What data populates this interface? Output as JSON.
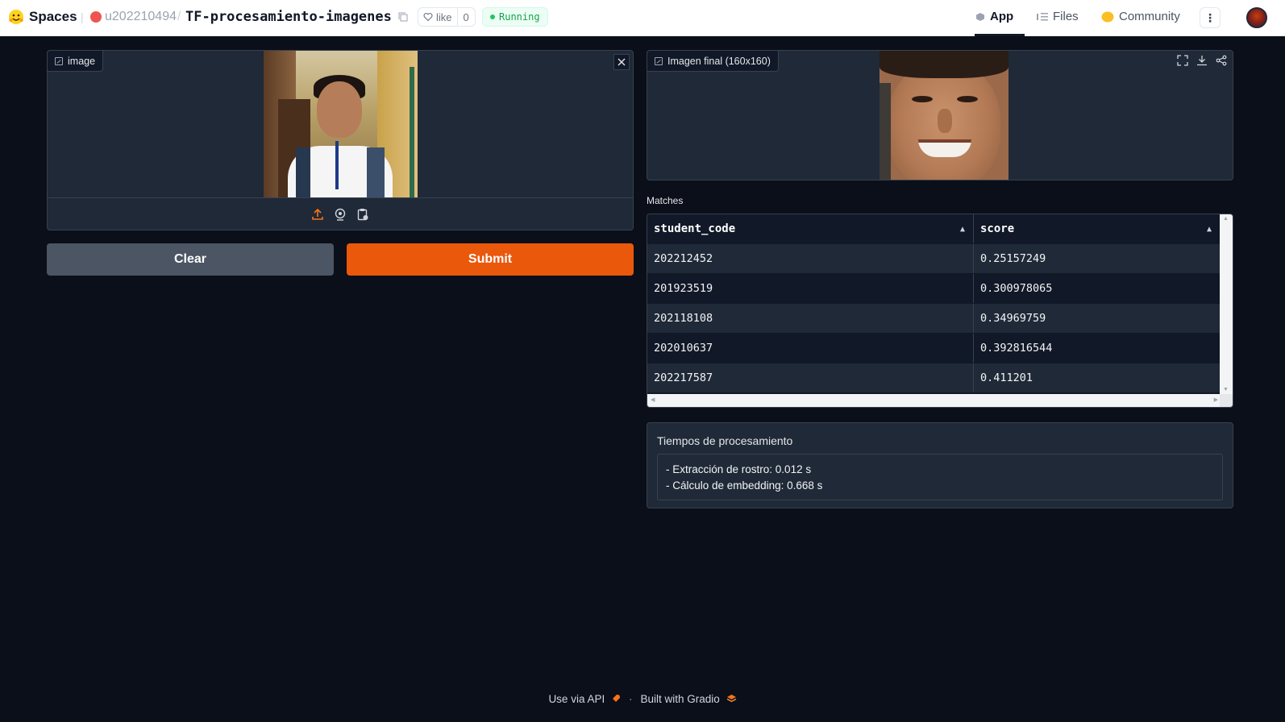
{
  "header": {
    "brand": "Spaces",
    "username": "u202210494",
    "separator": "/",
    "repo": "TF-procesamiento-imagenes",
    "like_label": "like",
    "like_count": "0",
    "status": "Running",
    "nav": {
      "app": "App",
      "files": "Files",
      "community": "Community"
    },
    "status_color": "#22c55e"
  },
  "input_image": {
    "label": "image"
  },
  "output_image": {
    "label": "Imagen final (160x160)"
  },
  "buttons": {
    "clear": "Clear",
    "submit": "Submit",
    "submit_color": "#ea580c"
  },
  "matches": {
    "label": "Matches",
    "columns": [
      "student_code",
      "score"
    ],
    "rows": [
      [
        "202212452",
        "0.25157249"
      ],
      [
        "201923519",
        "0.300978065"
      ],
      [
        "202118108",
        "0.34969759"
      ],
      [
        "202010637",
        "0.392816544"
      ],
      [
        "202217587",
        "0.411201"
      ]
    ]
  },
  "tiempos": {
    "label": "Tiempos de procesamiento",
    "lines": [
      "- Extracción de rostro: 0.012 s",
      "- Cálculo de embedding: 0.668 s"
    ]
  },
  "footer": {
    "api": "Use via API",
    "dot": "·",
    "built": "Built with Gradio"
  }
}
